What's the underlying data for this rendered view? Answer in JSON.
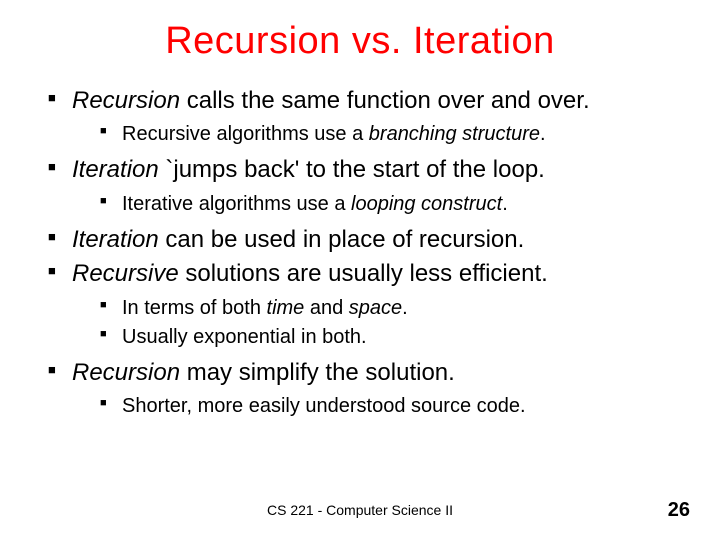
{
  "title": "Recursion vs. Iteration",
  "bullets": [
    {
      "segs": [
        {
          "t": "Recursion",
          "i": true
        },
        {
          "t": " calls the same function over and over."
        }
      ],
      "sub": [
        {
          "segs": [
            {
              "t": "Recursive algorithms use a "
            },
            {
              "t": "branching structure",
              "i": true
            },
            {
              "t": "."
            }
          ]
        }
      ]
    },
    {
      "segs": [
        {
          "t": "Iteration",
          "i": true
        },
        {
          "t": " `jumps back' to the start of the loop."
        }
      ],
      "sub": [
        {
          "segs": [
            {
              "t": "Iterative algorithms use a "
            },
            {
              "t": "looping construct",
              "i": true
            },
            {
              "t": "."
            }
          ]
        }
      ]
    },
    {
      "segs": [
        {
          "t": "Iteration",
          "i": true
        },
        {
          "t": " can be used in place of recursion."
        }
      ],
      "sub": []
    },
    {
      "segs": [
        {
          "t": "Recursive",
          "i": true
        },
        {
          "t": " solutions are usually less efficient."
        }
      ],
      "sub": [
        {
          "segs": [
            {
              "t": "In terms of both "
            },
            {
              "t": "time",
              "i": true
            },
            {
              "t": " and "
            },
            {
              "t": "space",
              "i": true
            },
            {
              "t": "."
            }
          ]
        },
        {
          "segs": [
            {
              "t": "Usually exponential in both."
            }
          ]
        }
      ]
    },
    {
      "segs": [
        {
          "t": "Recursion",
          "i": true
        },
        {
          "t": " may simplify the solution."
        }
      ],
      "sub": [
        {
          "segs": [
            {
              "t": "Shorter, more easily understood source code."
            }
          ]
        }
      ]
    }
  ],
  "footer": "CS 221 - Computer Science II",
  "page": "26"
}
